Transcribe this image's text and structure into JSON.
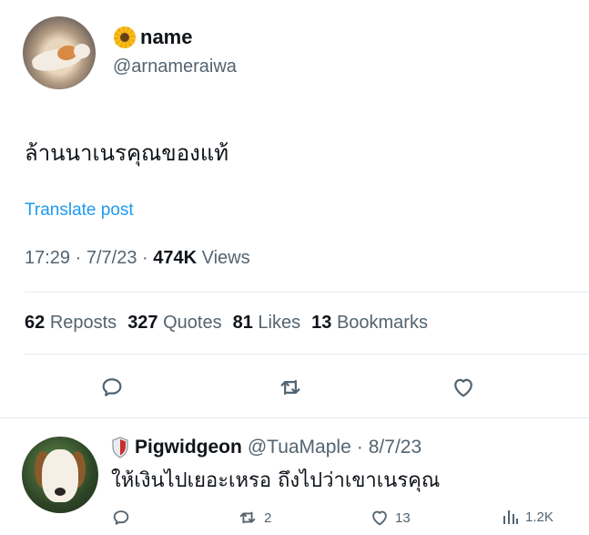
{
  "post": {
    "display_name": "name",
    "name_emoji": "sunflower-emoji",
    "handle": "@arnameraiwa",
    "text": "ล้านนาเนรคุณของแท้",
    "translate_label": "Translate post",
    "time": "17:29",
    "date": "7/7/23",
    "views_count": "474K",
    "views_label": "Views",
    "stats": [
      {
        "count": "62",
        "label": "Reposts"
      },
      {
        "count": "327",
        "label": "Quotes"
      },
      {
        "count": "81",
        "label": "Likes"
      },
      {
        "count": "13",
        "label": "Bookmarks"
      }
    ],
    "actions": [
      "reply-icon",
      "repost-icon",
      "like-icon"
    ]
  },
  "reply": {
    "display_name": "Pigwidgeon",
    "handle": "@TuaMaple",
    "date": "8/7/23",
    "text": "ให้เงินไปเยอะเหรอ ถึงไปว่าเขาเนรคุณ",
    "reposts": "2",
    "likes": "13",
    "views": "1.2K"
  },
  "colors": {
    "accent": "#1d9bf0",
    "text_primary": "#0f1419",
    "text_secondary": "#536471",
    "divider": "#e6e9ec"
  }
}
